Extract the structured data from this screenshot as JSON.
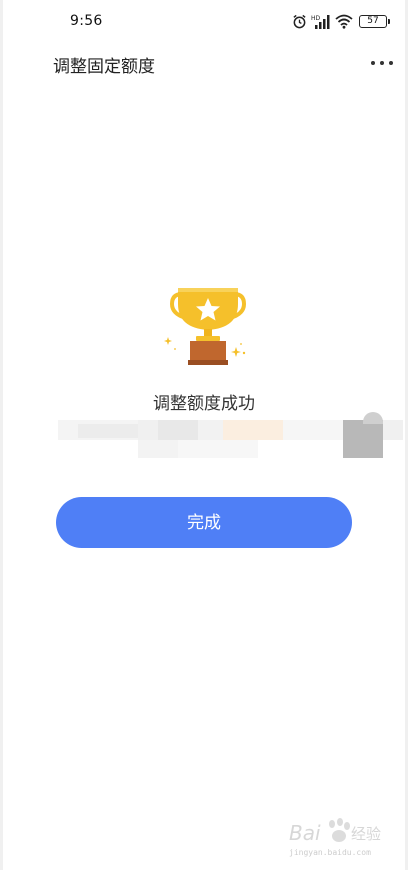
{
  "status_bar": {
    "time": "9:56",
    "battery": "57"
  },
  "nav": {
    "title": "调整固定额度"
  },
  "result": {
    "message": "调整额度成功"
  },
  "actions": {
    "done_label": "完成"
  },
  "colors": {
    "primary": "#4f7ff6",
    "trophy_gold": "#f5c02b",
    "trophy_base": "#c0672e"
  },
  "watermark": {
    "logo": "Bai 经验",
    "url": "jingyan.baidu.com"
  }
}
